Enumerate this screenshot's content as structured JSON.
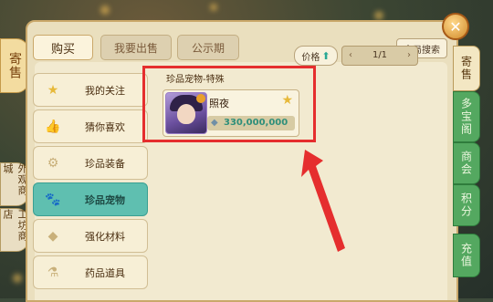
{
  "left_tabs": {
    "main": "寄售",
    "external": "外观商城",
    "workshop": "工坊商店"
  },
  "tabs": [
    {
      "label": "购买"
    },
    {
      "label": "我要出售"
    },
    {
      "label": "公示期"
    }
  ],
  "search_button": "全局搜索",
  "categories": [
    {
      "label": "我的关注",
      "icon": "star-icon"
    },
    {
      "label": "猜你喜欢",
      "icon": "thumbs-up-icon"
    },
    {
      "label": "珍品装备",
      "icon": "equipment-icon"
    },
    {
      "label": "珍品宠物",
      "icon": "pet-icon",
      "selected": true
    },
    {
      "label": "强化材料",
      "icon": "material-icon"
    },
    {
      "label": "药品道具",
      "icon": "potion-icon"
    }
  ],
  "sort": {
    "label": "价格",
    "direction": "up"
  },
  "pager": {
    "text": "1/1"
  },
  "section_title": "珍品宠物-特殊",
  "items": [
    {
      "name": "照夜",
      "price": "330,000,000"
    }
  ],
  "right_tabs": [
    {
      "label": "寄售",
      "selected": true
    },
    {
      "label": "多宝阁"
    },
    {
      "label": "商会"
    },
    {
      "label": "积分"
    },
    {
      "label": "充值"
    }
  ],
  "colors": {
    "highlight": "#e52e2e",
    "selected_category": "#5fbfb0",
    "price": "#2f8f7a"
  }
}
